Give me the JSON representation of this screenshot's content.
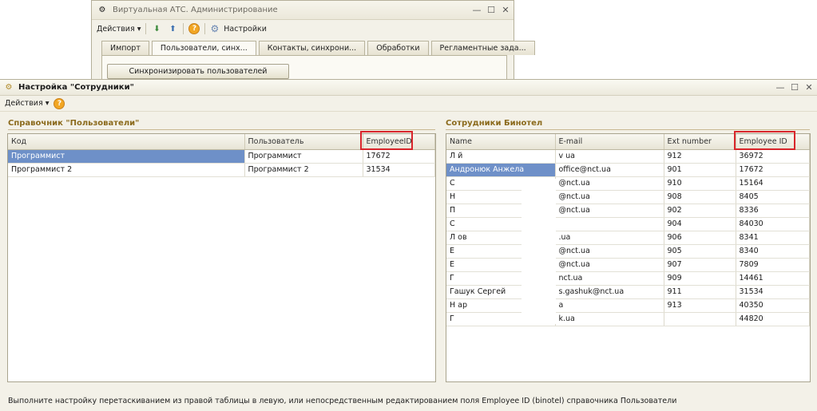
{
  "bg_window": {
    "title": "Виртуальная АТС. Администрирование",
    "toolbar": {
      "actions_label": "Действия",
      "settings_label": "Настройки"
    },
    "tabs": [
      "Импорт",
      "Пользователи, синх...",
      "Контакты, синхрони...",
      "Обработки",
      "Регламентные зада..."
    ],
    "sync_button": "Синхронизировать пользователей"
  },
  "main_window": {
    "title": "Настройка \"Сотрудники\"",
    "toolbar": {
      "actions_label": "Действия"
    }
  },
  "left_panel": {
    "title": "Справочник \"Пользователи\"",
    "columns": [
      "Код",
      "Пользователь",
      "EmployeeID"
    ],
    "rows": [
      [
        "Программист",
        "Программист",
        "17672"
      ],
      [
        "Программист 2",
        "Программист 2",
        "31534"
      ]
    ]
  },
  "right_panel": {
    "title": "Сотрудники Бинотел",
    "columns": [
      "Name",
      "E-mail",
      "Ext number",
      "Employee ID"
    ],
    "rows": [
      [
        "Л            й",
        "v             ua",
        "912",
        "36972"
      ],
      [
        "Андронюк Анжела",
        "office@nct.ua",
        "901",
        "17672"
      ],
      [
        "С",
        "            @nct.ua",
        "910",
        "15164"
      ],
      [
        "Н",
        "            @nct.ua",
        "908",
        "8405"
      ],
      [
        "П",
        "            @nct.ua",
        "902",
        "8336"
      ],
      [
        "С",
        "",
        "904",
        "84030"
      ],
      [
        "Л                    ов",
        "            .ua",
        "906",
        "8341"
      ],
      [
        "Е",
        "            @nct.ua",
        "905",
        "8340"
      ],
      [
        "Е",
        "            @nct.ua",
        "907",
        "7809"
      ],
      [
        "Г",
        "            nct.ua",
        "909",
        "14461"
      ],
      [
        "Гашук Сергей",
        "s.gashuk@nct.ua",
        "911",
        "31534"
      ],
      [
        "Н                  ар",
        "            а",
        "913",
        "40350"
      ],
      [
        "Г",
        "            k.ua",
        "",
        "44820"
      ]
    ]
  },
  "footer": "Выполните настройку перетаскиванием из правой таблицы в левую, или непосредственным редактированием поля Employee ID (binotel) справочника Пользователи",
  "colors": {
    "selection": "#6e90c8",
    "highlight_box": "#d8252b",
    "section_title": "#8b6a1c"
  }
}
